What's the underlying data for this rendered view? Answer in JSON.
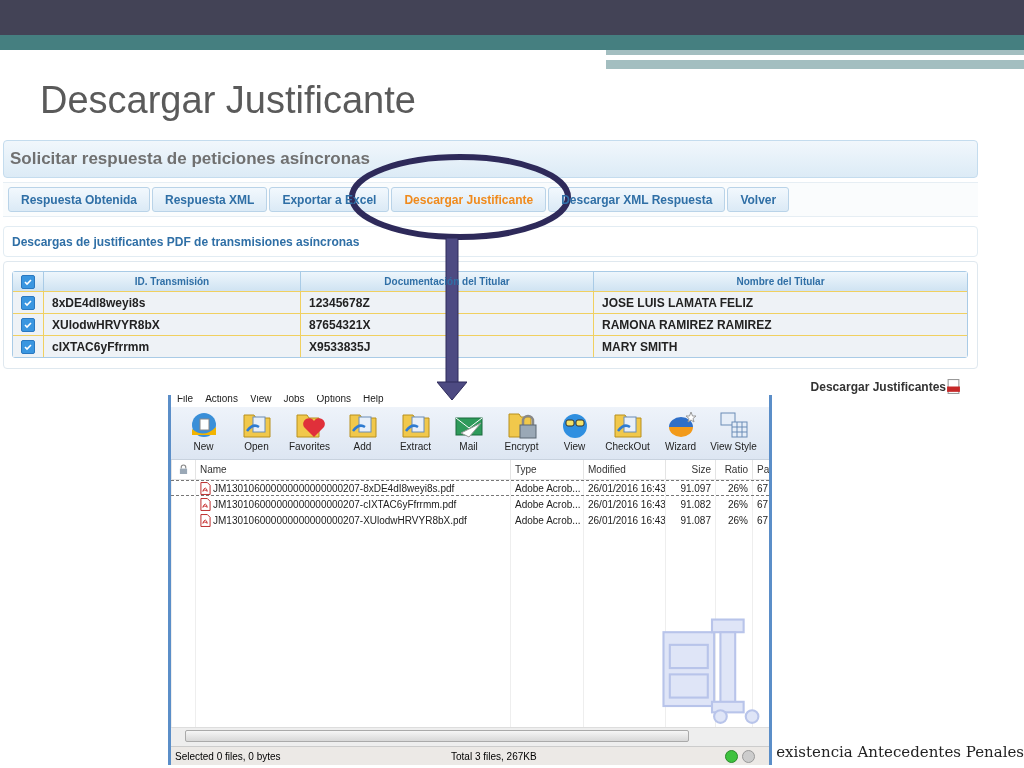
{
  "slide": {
    "title": "Descargar Justificante",
    "footer": "existencia Antecedentes Penales"
  },
  "web_app": {
    "panel_title": "Solicitar respuesta de peticiones asíncronas",
    "buttons": [
      {
        "label": "Respuesta Obtenida",
        "selected": false
      },
      {
        "label": "Respuesta XML",
        "selected": false
      },
      {
        "label": "Exportar a Excel",
        "selected": false
      },
      {
        "label": "Descargar Justificante",
        "selected": true
      },
      {
        "label": "Descargar XML Respuesta",
        "selected": false
      },
      {
        "label": "Volver",
        "selected": false
      }
    ],
    "section_title": "Descargas de justificantes PDF de transmisiones asíncronas",
    "table": {
      "select_all_checked": true,
      "columns": [
        "ID. Transmisión",
        "Documentación del Titular",
        "Nombre del Titular"
      ],
      "rows": [
        {
          "checked": true,
          "cells": [
            "8xDE4dI8weyi8s",
            "12345678Z",
            "JOSE LUIS LAMATA FELIZ"
          ]
        },
        {
          "checked": true,
          "cells": [
            "XUlodwHRVYR8bX",
            "87654321X",
            "RAMONA RAMIREZ RAMIREZ"
          ]
        },
        {
          "checked": true,
          "cells": [
            "cIXTAC6yFfrrmm",
            "X9533835J",
            "MARY SMITH"
          ]
        }
      ]
    },
    "download_link": "Descargar Justificantes"
  },
  "winzip": {
    "menu": [
      "File",
      "Actions",
      "View",
      "Jobs",
      "Options",
      "Help"
    ],
    "toolbar": [
      {
        "label": "New",
        "kind": "globe"
      },
      {
        "label": "Open",
        "kind": "folder"
      },
      {
        "label": "Favorites",
        "kind": "heart"
      },
      {
        "label": "Add",
        "kind": "folder"
      },
      {
        "label": "Extract",
        "kind": "folder"
      },
      {
        "label": "Mail",
        "kind": "mail"
      },
      {
        "label": "Encrypt",
        "kind": "lock"
      },
      {
        "label": "View",
        "kind": "glasses"
      },
      {
        "label": "CheckOut",
        "kind": "folder"
      },
      {
        "label": "Wizard",
        "kind": "wizard"
      },
      {
        "label": "View Style",
        "kind": "grid"
      }
    ],
    "columns": [
      "Name",
      "Type",
      "Modified",
      "Size",
      "Ratio",
      "Pa"
    ],
    "files": [
      {
        "focused": true,
        "cells": [
          "JM130106000000000000000207-8xDE4dI8weyi8s.pdf",
          "Adobe Acrob...",
          "26/01/2016 16:43",
          "91.097",
          "26%",
          "67"
        ]
      },
      {
        "focused": false,
        "cells": [
          "JM130106000000000000000207-cIXTAC6yFfrrmm.pdf",
          "Adobe Acrob...",
          "26/01/2016 16:43",
          "91.082",
          "26%",
          "67"
        ]
      },
      {
        "focused": false,
        "cells": [
          "JM130106000000000000000207-XUlodwHRVYR8bX.pdf",
          "Adobe Acrob...",
          "26/01/2016 16:43",
          "91.087",
          "26%",
          "67"
        ]
      }
    ],
    "status_selected": "Selected 0 files, 0 bytes",
    "status_total": "Total 3 files, 267KB"
  }
}
